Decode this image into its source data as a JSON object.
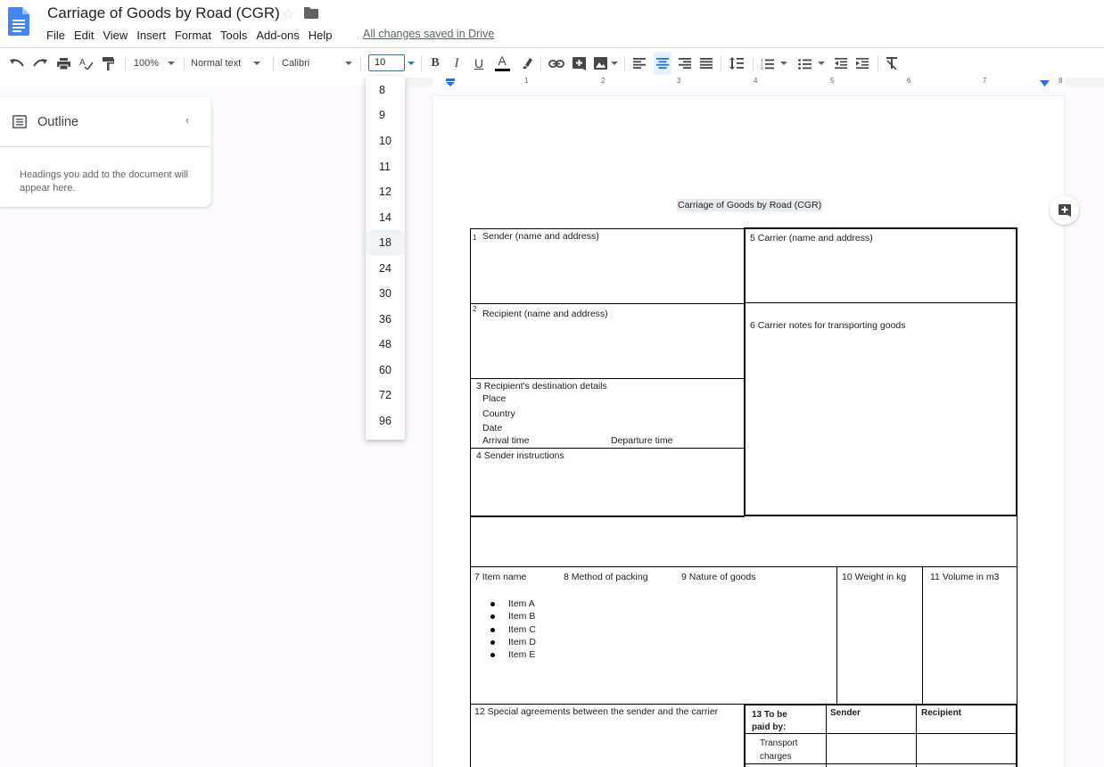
{
  "doc": {
    "title": "Carriage of Goods by Road (CGR)",
    "save_status": "All changes saved in Drive"
  },
  "menu": [
    "File",
    "Edit",
    "View",
    "Insert",
    "Format",
    "Tools",
    "Add-ons",
    "Help"
  ],
  "toolbar": {
    "zoom": "100%",
    "style": "Normal text",
    "font": "Calibri",
    "font_size": "10",
    "icons": [
      "undo-icon",
      "redo-icon",
      "print-icon",
      "spellcheck-icon",
      "paint-format-icon",
      "bold-icon",
      "italic-icon",
      "underline-icon",
      "text-color-icon",
      "highlight-icon",
      "link-icon",
      "comment-icon",
      "image-icon",
      "align-left-icon",
      "align-center-icon",
      "align-right-icon",
      "justify-icon",
      "line-spacing-icon",
      "numbered-list-icon",
      "bulleted-list-icon",
      "decrease-indent-icon",
      "increase-indent-icon",
      "clear-formatting-icon"
    ],
    "bold_label": "B",
    "italic_label": "I",
    "underline_label": "U",
    "text_color_label": "A",
    "accent_color": "#1a73e8"
  },
  "font_size_options": [
    "8",
    "9",
    "10",
    "11",
    "12",
    "14",
    "18",
    "24",
    "30",
    "36",
    "48",
    "60",
    "72",
    "96"
  ],
  "font_size_hovered": "18",
  "ruler": [
    "1",
    "2",
    "3",
    "4",
    "5",
    "6",
    "7",
    "8"
  ],
  "outline": {
    "title": "Outline",
    "hint": "Headings you add to the document will appear here."
  },
  "page": {
    "heading": "Carriage of Goods by Road (CGR)",
    "sender": "Sender (name and address)",
    "sender_num": "1",
    "carrier": "5 Carrier (name and address)",
    "recipient_num": "2",
    "recipient": "Recipient (name and address)",
    "carrier_notes": "6 Carrier notes for transporting goods",
    "destination": "3 Recipient's destination details",
    "place": "Place",
    "country": "Country",
    "date": "Date",
    "arrival": "Arrival time",
    "departure": "Departure time",
    "instructions": "4 Sender instructions",
    "item_name": "7 Item name",
    "packing": "8 Method of packing",
    "nature": "9 Nature of goods",
    "weight": "10 Weight in kg",
    "volume": "11 Volume in m3",
    "items": [
      "Item A",
      "Item B",
      "Item C",
      "Item D",
      "Item E"
    ],
    "special": "12 Special agreements between the sender and the carrier",
    "paid_by": "13 To be paid by:",
    "col_sender": "Sender",
    "col_recipient": "Recipient",
    "transport": "Transport charges"
  }
}
